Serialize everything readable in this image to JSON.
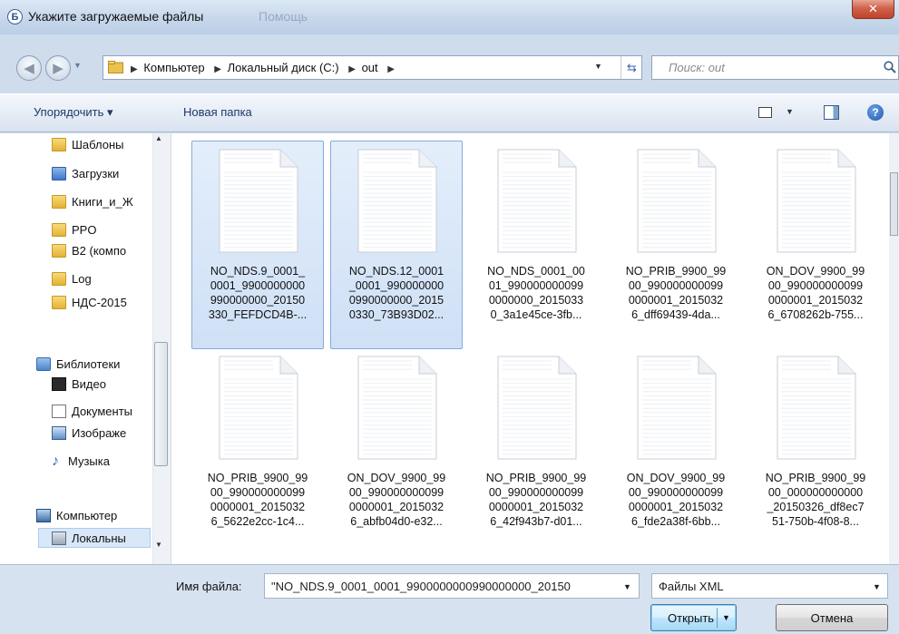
{
  "window": {
    "title": "Укажите загружаемые файлы",
    "title_ghost": "Помощь",
    "close_glyph": "✕",
    "title_icon_glyph": "Б"
  },
  "address": {
    "crumbs": [
      "Компьютер",
      "Локальный диск (C:)",
      "out"
    ],
    "search_placeholder": "Поиск: out"
  },
  "toolbar": {
    "organize": "Упорядочить ▾",
    "new_folder": "Новая папка",
    "help": "?"
  },
  "nav": {
    "items": [
      {
        "label": "Шаблоны",
        "icon": "folder-icon"
      },
      {
        "label": "Загрузки",
        "icon": "downloads-icon"
      },
      {
        "label": "Книги_и_Ж",
        "icon": "folder-icon"
      },
      {
        "label": "PPO",
        "icon": "folder-icon"
      },
      {
        "label": "B2 (компо",
        "icon": "folder-icon"
      },
      {
        "label": "Log",
        "icon": "folder-icon"
      },
      {
        "label": "НДС-2015",
        "icon": "folder-icon"
      },
      {
        "label": "Библиотеки",
        "icon": "libraries-icon"
      },
      {
        "label": "Видео",
        "icon": "video-icon"
      },
      {
        "label": "Документы",
        "icon": "documents-icon"
      },
      {
        "label": "Изображе",
        "icon": "pictures-icon"
      },
      {
        "label": "Музыка",
        "icon": "music-icon"
      },
      {
        "label": "Компьютер",
        "icon": "computer-icon"
      },
      {
        "label": "Локальны",
        "icon": "local-disk-icon"
      }
    ]
  },
  "files": [
    {
      "name": "NO_NDS.9_0001_\n0001_9900000000\n990000000_20150\n330_FEFDCD4B-...",
      "selected": true
    },
    {
      "name": "NO_NDS.12_0001\n_0001_990000000\n0990000000_2015\n0330_73B93D02...",
      "selected": true
    },
    {
      "name": "NO_NDS_0001_00\n01_990000000099\n0000000_2015033\n0_3a1e45ce-3fb...",
      "selected": false
    },
    {
      "name": "NO_PRIB_9900_99\n00_990000000099\n0000001_2015032\n6_dff69439-4da...",
      "selected": false
    },
    {
      "name": "ON_DOV_9900_99\n00_990000000099\n0000001_2015032\n6_6708262b-755...",
      "selected": false
    },
    {
      "name": "NO_PRIB_9900_99\n00_990000000099\n0000001_2015032\n6_5622e2cc-1c4...",
      "selected": false
    },
    {
      "name": "ON_DOV_9900_99\n00_990000000099\n0000001_2015032\n6_abfb04d0-e32...",
      "selected": false
    },
    {
      "name": "NO_PRIB_9900_99\n00_990000000099\n0000001_2015032\n6_42f943b7-d01...",
      "selected": false
    },
    {
      "name": "ON_DOV_9900_99\n00_990000000099\n0000001_2015032\n6_fde2a38f-6bb...",
      "selected": false
    },
    {
      "name": "NO_PRIB_9900_99\n00_000000000000\n_20150326_df8ec7\n51-750b-4f08-8...",
      "selected": false
    }
  ],
  "footer": {
    "filename_label": "Имя файла:",
    "filename_value": "\"NO_NDS.9_0001_0001_9900000000990000000_20150",
    "filetype_value": "Файлы XML",
    "open_label": "Открыть",
    "cancel_label": "Отмена"
  }
}
